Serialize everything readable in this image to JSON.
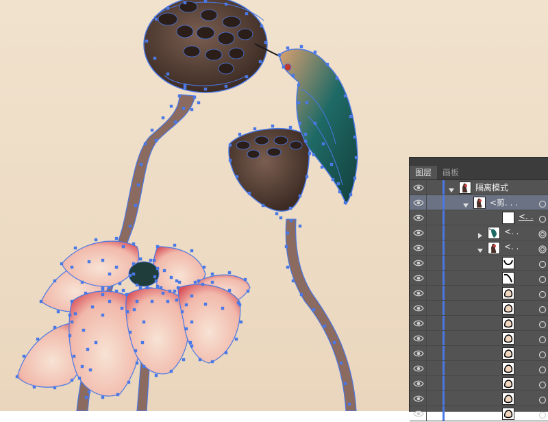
{
  "canvas": {
    "background_top": "#f1e2cd",
    "background_bottom": "#ead6bd",
    "path_color": "#4a78e6",
    "stem_color": "#8b6a60",
    "pod_color": "#5a4438",
    "petal_color": "#f3c2b4",
    "petal_edge": "#d9505a",
    "bird_color": "#1f6a66"
  },
  "panel": {
    "tabs": [
      "图层",
      "画板"
    ],
    "active_tab": 0,
    "rows": [
      {
        "name": "隔离模式",
        "indent": 0,
        "expander": "down",
        "thumb": "figure",
        "selected": false,
        "underline": false,
        "target": "none"
      },
      {
        "name": "<剪. . .",
        "indent": 1,
        "expander": "down",
        "thumb": "figure",
        "selected": true,
        "underline": false,
        "target": "single"
      },
      {
        "name": "<. .",
        "indent": 3,
        "expander": "none",
        "thumb": "blank",
        "selected": false,
        "underline": true,
        "target": "single"
      },
      {
        "name": "<. .",
        "indent": 2,
        "expander": "right",
        "thumb": "bird",
        "selected": false,
        "underline": false,
        "target": "double"
      },
      {
        "name": "<. .",
        "indent": 2,
        "expander": "down",
        "thumb": "figure",
        "selected": false,
        "underline": false,
        "target": "double"
      },
      {
        "name": "",
        "indent": 3,
        "expander": "none",
        "thumb": "curve",
        "selected": false,
        "underline": false,
        "target": "single"
      },
      {
        "name": "",
        "indent": 3,
        "expander": "none",
        "thumb": "wedge",
        "selected": false,
        "underline": false,
        "target": "single"
      },
      {
        "name": "",
        "indent": 3,
        "expander": "none",
        "thumb": "petal",
        "selected": false,
        "underline": false,
        "target": "single"
      },
      {
        "name": "",
        "indent": 3,
        "expander": "none",
        "thumb": "petal",
        "selected": false,
        "underline": false,
        "target": "single"
      },
      {
        "name": "",
        "indent": 3,
        "expander": "none",
        "thumb": "petal",
        "selected": false,
        "underline": false,
        "target": "single"
      },
      {
        "name": "",
        "indent": 3,
        "expander": "none",
        "thumb": "petal",
        "selected": false,
        "underline": false,
        "target": "single"
      },
      {
        "name": "",
        "indent": 3,
        "expander": "none",
        "thumb": "petal",
        "selected": false,
        "underline": false,
        "target": "single"
      },
      {
        "name": "",
        "indent": 3,
        "expander": "none",
        "thumb": "petal",
        "selected": false,
        "underline": false,
        "target": "single"
      },
      {
        "name": "",
        "indent": 3,
        "expander": "none",
        "thumb": "petal",
        "selected": false,
        "underline": false,
        "target": "single"
      },
      {
        "name": "",
        "indent": 3,
        "expander": "none",
        "thumb": "petal",
        "selected": false,
        "underline": false,
        "target": "single"
      },
      {
        "name": "",
        "indent": 3,
        "expander": "none",
        "thumb": "petal",
        "selected": false,
        "underline": false,
        "target": "single"
      }
    ]
  }
}
